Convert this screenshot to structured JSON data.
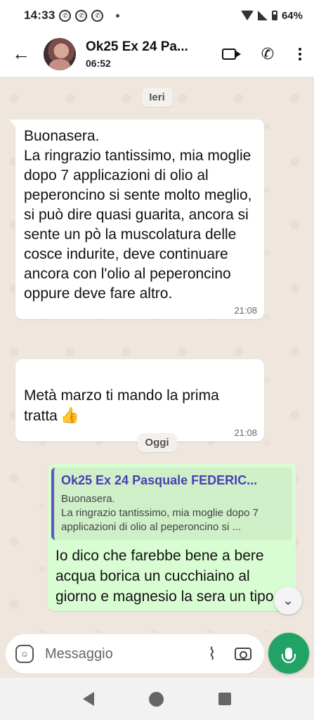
{
  "status_bar": {
    "time": "14:33",
    "battery": "64%",
    "notification_icons": [
      "whatsapp-icon",
      "whatsapp-icon",
      "whatsapp-icon"
    ]
  },
  "header": {
    "contact_name": "Ok25 Ex 24 Pa...",
    "subtitle": "06:52"
  },
  "chat": {
    "date_yesterday": "Ieri",
    "messages_in": [
      {
        "text": "Buonasera.\nLa ringrazio tantissimo, mia moglie dopo 7 applicazioni di olio al peperoncino si sente molto meglio, si può dire quasi guarita, ancora si sente un pò la muscolatura delle cosce indurite, deve continuare ancora con l'olio al peperoncino oppure deve fare altro.",
        "time": "21:08"
      },
      {
        "text": "Metà marzo ti mando la prima tratta",
        "emoji": "👍",
        "time": "21:08"
      }
    ],
    "date_today": "Oggi",
    "message_out": {
      "quote_name": "Ok25 Ex 24 Pasquale FEDERIC...",
      "quote_text": "Buonasera.\nLa ringrazio tantissimo, mia moglie dopo 7 applicazioni di olio al peperoncino si ...",
      "text": "Io dico che farebbe bene a bere acqua borica un cucchiaino al giorno e magnesio la sera un tipo"
    }
  },
  "input": {
    "placeholder": "Messaggio"
  },
  "colors": {
    "chat_background": "#efe7dd",
    "outgoing_bubble": "#d9fdd3",
    "incoming_bubble": "#ffffff",
    "accent_green": "#21a366",
    "quote_accent": "#5e54c8"
  }
}
